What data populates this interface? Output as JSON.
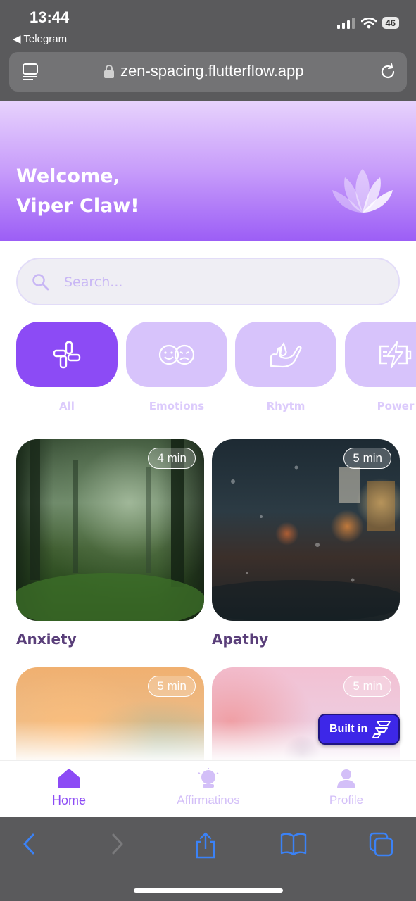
{
  "status_bar": {
    "time": "13:44",
    "back_app": "◀ Telegram",
    "battery": "46"
  },
  "browser": {
    "url": "zen-spacing.flutterflow.app"
  },
  "header": {
    "welcome_line1": "Welcome,",
    "welcome_line2": "Viper Claw!",
    "gradient_colors": [
      "#e7d2fd",
      "#9c5ef6"
    ]
  },
  "search": {
    "placeholder": "Search...",
    "value": ""
  },
  "categories": [
    {
      "label": "All",
      "icon": "grid-blocks-icon",
      "active": true
    },
    {
      "label": "Emotions",
      "icon": "emotions-faces-icon",
      "active": false
    },
    {
      "label": "Rhytm",
      "icon": "hand-drop-icon",
      "active": false
    },
    {
      "label": "Power",
      "icon": "battery-bolt-icon",
      "active": false
    }
  ],
  "cards": [
    {
      "title": "Anxiety",
      "duration": "4 min",
      "image": "forest-image"
    },
    {
      "title": "Apathy",
      "duration": "5 min",
      "image": "rainy-street-image"
    },
    {
      "title": "",
      "duration": "5 min",
      "image": "nebula-image"
    },
    {
      "title": "",
      "duration": "5 min",
      "image": "girl-clouds-image"
    }
  ],
  "badge": {
    "label": "Built in"
  },
  "bottom_nav": [
    {
      "label": "Home",
      "icon": "home-icon",
      "active": true
    },
    {
      "label": "Affirmatinos",
      "icon": "crystal-ball-icon",
      "active": false
    },
    {
      "label": "Profile",
      "icon": "person-icon",
      "active": false
    }
  ],
  "colors": {
    "accent": "#8c4bf5",
    "accent_light": "#d7c3fb",
    "title_text": "#5a3f7a"
  }
}
